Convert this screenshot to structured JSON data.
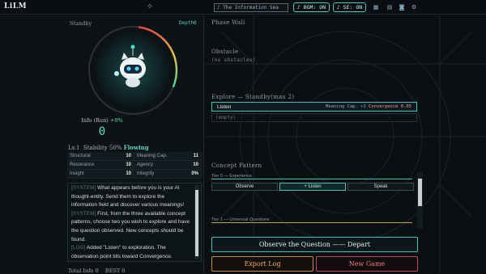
{
  "app": {
    "title": "LiLM"
  },
  "topbar": {
    "track_value": "♪ The Information Sea",
    "bgm_label": "♪ BGM: ON",
    "se_label": "♪ SE: ON",
    "icons": [
      "grid-icon",
      "book-icon",
      "save-icon",
      "gear-icon"
    ]
  },
  "status": {
    "state": "Standby",
    "depth": "Depth0",
    "info_label": "Info (Run)",
    "info_pct": "+0%",
    "info_value": "0",
    "gauge_level": 0.55,
    "level": "Lv.1",
    "stability": "Stability 50%",
    "flow": "Flowing"
  },
  "stats": [
    [
      {
        "k": "Structural",
        "v": "10"
      },
      {
        "k": "Meaning Cap.",
        "v": "11"
      }
    ],
    [
      {
        "k": "Resonance",
        "v": "10"
      },
      {
        "k": "Agency",
        "v": "10"
      }
    ],
    [
      {
        "k": "Insight",
        "v": "10"
      },
      {
        "k": "Integrity",
        "v": "0%"
      }
    ]
  ],
  "log": {
    "line1_prefix": "[SYSTEM]",
    "line1": " What appears before you is your AI thought-entity. Send them to explore the information field and discover various meanings!",
    "line2_prefix": "[SYSTEM]",
    "line2": " First, from the three available concept patterns, choose two you wish to explore and have the question observed. New concepts should be found.",
    "line3_prefix": "[LOG]",
    "line3": " Added \"Listen\" to exploration. The observation point tilts toward Convergence."
  },
  "footer": {
    "total": "Total Info 0",
    "best": "BEST 0"
  },
  "right": {
    "phase_wall": "Phase Wall",
    "obstacle": "Obstacle",
    "obstacle_value": "(no obstacles)",
    "explore_title": "Explore — Standby(max 2)",
    "explore_item": "Listen",
    "explore_meta": "Meaning Cap. +1",
    "explore_conv": "Convergence 0.05",
    "explore_empty": "(empty)",
    "concept_title": "Concept Pattern",
    "tier0": "Tier 0 — Experience",
    "tier1": "Tier 1 — Universal Questions",
    "btn_observe": "Observe",
    "btn_listen": "+ Listen",
    "btn_speak": "Speak",
    "depart": "Observe the Question —— Depart",
    "export": "Export Log",
    "new_game": "New Game"
  },
  "colors": {
    "accent": "#3cc6b8",
    "warn": "#c98a3a",
    "danger": "#b94a5e"
  }
}
